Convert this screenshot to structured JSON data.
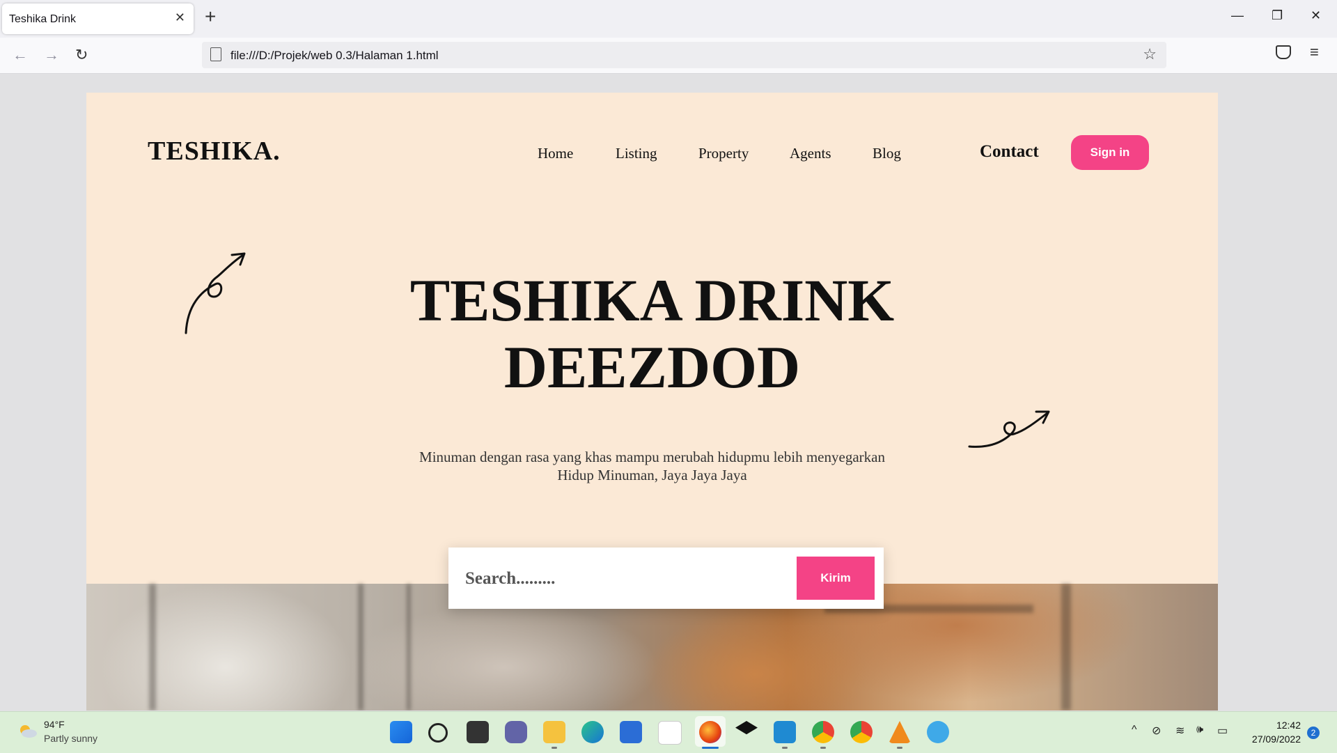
{
  "browser": {
    "tab_title": "Teshika Drink",
    "url": "file:///D:/Projek/web 0.3/Halaman 1.html"
  },
  "site": {
    "logo": "TESHIKA.",
    "nav": [
      "Home",
      "Listing",
      "Property",
      "Agents",
      "Blog"
    ],
    "contact": "Contact",
    "signin": "Sign in",
    "title_line1": "TESHIKA DRINK",
    "title_line2": "DEEZDOD",
    "subtitle_line1": "Minuman dengan rasa yang khas mampu merubah hidupmu lebih menyegarkan",
    "subtitle_line2": "Hidup Minuman, Jaya Jaya Jaya",
    "search_placeholder": "Search.........",
    "search_button": "Kirim",
    "accent_color": "#f44386",
    "hero_bg": "#fbe9d6"
  },
  "taskbar": {
    "temperature": "94°F",
    "condition": "Partly sunny",
    "time": "12:42",
    "date": "27/09/2022",
    "notifications": "2",
    "icons": [
      "windows-start-icon",
      "search-icon",
      "task-view-icon",
      "teams-chat-icon",
      "file-explorer-icon",
      "edge-icon",
      "store-icon",
      "amazon-icon",
      "firefox-icon",
      "dropbox-icon",
      "vscode-icon",
      "chrome-profile-icon",
      "chrome-icon",
      "vlc-icon",
      "paint-icon"
    ]
  }
}
